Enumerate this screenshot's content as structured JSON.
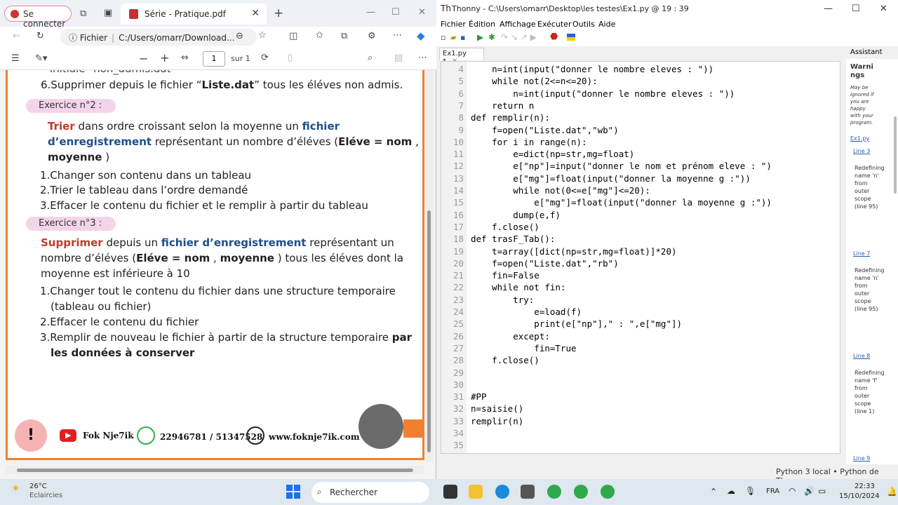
{
  "edge": {
    "tab_title": "Série - Pratique.pdf",
    "sign_in": "Se connecter",
    "url_label": "Fichier",
    "url": "C:/Users/omarr/Download...",
    "page_current": "1",
    "page_total": "sur 1"
  },
  "pdf": {
    "line_top": "initiale \"non_admis.dat\"",
    "item6_a": "6.Supprimer depuis le fichier “",
    "item6_b": "Liste.dat",
    "item6_c": "” tous les éléves non admis.",
    "ex2_label": "Exercice n°2 :",
    "ex2_l1_a": "Trier",
    "ex2_l1_b": " dans ordre croissant selon la moyenne un ",
    "ex2_l1_c": "fichier",
    "ex2_l2_a": "d’enregistrement",
    "ex2_l2_b": " représentant un nombre d’éléves (",
    "ex2_l2_c": "Eléve = nom",
    "ex2_l2_d": " ,",
    "ex2_l3_a": "moyenne",
    "ex2_l3_b": " )",
    "ex2_i1": "1.Changer son contenu dans un tableau",
    "ex2_i2": "2.Trier le tableau dans l’ordre demandé",
    "ex2_i3": "3.Effacer le contenu du fichier et le remplir à partir du tableau",
    "ex3_label": "Exercice n°3 :",
    "ex3_l1_a": "Supprimer",
    "ex3_l1_b": " depuis  un ",
    "ex3_l1_c": "fichier d’enregistrement",
    "ex3_l1_d": " représentant un",
    "ex3_l2_a": "nombre d’éléves (",
    "ex3_l2_b": "Eléve = nom",
    "ex3_l2_c": " , ",
    "ex3_l2_d": "moyenne",
    "ex3_l2_e": " ) tous les éléves dont la",
    "ex3_l3": "moyenne est inférieure à 10",
    "ex3_i1": "1.Changer tout le contenu du fichier dans une structure temporaire",
    "ex3_i1b": "(tableau ou fichier)",
    "ex3_i2": "2.Effacer le contenu du fichier",
    "ex3_i3_a": "3.Remplir de nouveau le fichier à partir de la structure temporaire ",
    "ex3_i3_b": "par",
    "ex3_i3_c": "les données à conserver",
    "footer_name": "Fok Nje7ik",
    "footer_phone": "22946781 / 51347528",
    "footer_web": "www.foknje7ik.com"
  },
  "thonny": {
    "title": "Thonny  -  C:\\Users\\omarr\\Desktop\\les testes\\Ex1.py  @  19 : 39",
    "menu": [
      "Fichier",
      "Édition",
      "Affichage",
      "Exécuter",
      "Outils",
      "Aide"
    ],
    "tab": "Ex1.py *",
    "assistant_title": "Assistant",
    "assistant_warn": "Warnings",
    "assistant_note": "May be ignored if you are happy with your program.",
    "assistant_file": "Ex1.py",
    "assistant_items": [
      {
        "link": "Line 3",
        "text": "Redefining name 'n' from outer scope (line 95)"
      },
      {
        "link": "Line 7",
        "text": "Redefining name 'n' from outer scope (line 95)"
      },
      {
        "link": "Line 8",
        "text": "Redefining name 'f' from outer scope (line 1)"
      },
      {
        "link": "Line 9",
        "text": ""
      }
    ],
    "status_interp": "Python 3 local",
    "status_python": "Python de Thonny",
    "code": [
      {
        "n": "4",
        "t": "    n=int(input(\"donner le nombre eleves : \"))"
      },
      {
        "n": "5",
        "t": "    while not(2<=n<=20):"
      },
      {
        "n": "6",
        "t": "        n=int(input(\"donner le nombre eleves : \"))"
      },
      {
        "n": "7",
        "t": "    return n"
      },
      {
        "n": "8",
        "t": "def remplir(n):"
      },
      {
        "n": "9",
        "t": "    f=open(\"Liste.dat\",\"wb\")"
      },
      {
        "n": "10",
        "t": "    for i in range(n):"
      },
      {
        "n": "11",
        "t": "        e=dict(np=str,mg=float)"
      },
      {
        "n": "12",
        "t": "        e[\"np\"]=input(\"donner le nom et prénom eleve : \")"
      },
      {
        "n": "13",
        "t": "        e[\"mg\"]=float(input(\"donner la moyenne g :\"))"
      },
      {
        "n": "14",
        "t": "        while not(0<=e[\"mg\"]<=20):"
      },
      {
        "n": "15",
        "t": "            e[\"mg\"]=float(input(\"donner la moyenne g :\"))"
      },
      {
        "n": "16",
        "t": "        dump(e,f)"
      },
      {
        "n": "17",
        "t": "    f.close()"
      },
      {
        "n": "18",
        "t": "def trasF_Tab():"
      },
      {
        "n": "19",
        "t": "    t=array([dict(np=str,mg=float)]*20)"
      },
      {
        "n": "20",
        "t": "    f=open(\"Liste.dat\",\"rb\")"
      },
      {
        "n": "21",
        "t": "    fin=False"
      },
      {
        "n": "22",
        "t": "    while not fin:"
      },
      {
        "n": "23",
        "t": "        try:"
      },
      {
        "n": "24",
        "t": "            e=load(f)"
      },
      {
        "n": "25",
        "t": "            print(e[\"np\"],\" : \",e[\"mg\"])"
      },
      {
        "n": "26",
        "t": "        except:"
      },
      {
        "n": "27",
        "t": "            fin=True"
      },
      {
        "n": "28",
        "t": "    f.close()"
      },
      {
        "n": "29",
        "t": ""
      },
      {
        "n": "30",
        "t": ""
      },
      {
        "n": "31",
        "t": "#PP"
      },
      {
        "n": "32",
        "t": "n=saisie()"
      },
      {
        "n": "33",
        "t": "remplir(n)"
      },
      {
        "n": "34",
        "t": ""
      },
      {
        "n": "35",
        "t": ""
      }
    ]
  },
  "taskbar": {
    "temp": "26°C",
    "weather": "Eclaircies",
    "search": "Rechercher",
    "lang": "FRA",
    "time": "22:33",
    "date": "15/10/2024"
  }
}
